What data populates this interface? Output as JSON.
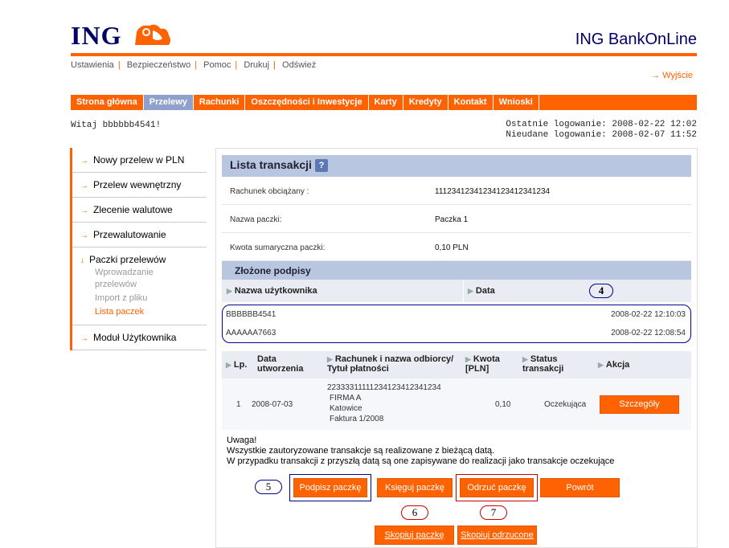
{
  "header": {
    "logo": "ING",
    "brand": "ING BankOnLine"
  },
  "util": [
    "Ustawienia",
    "Bezpieczeństwo",
    "Pomoc",
    "Drukuj",
    "Odśwież"
  ],
  "exit": "→ Wyjście",
  "nav": [
    "Strona główna",
    "Przelewy",
    "Rachunki",
    "Oszczędności i Inwestycje",
    "Karty",
    "Kredyty",
    "Kontakt",
    "Wnioski"
  ],
  "welcome": "Witaj bbbbbb4541!",
  "login": {
    "last": "Ostatnie logowanie: 2008-02-22 12:02",
    "failed": "Nieudane logowanie: 2008-02-07 11:52"
  },
  "sidebar": {
    "items": [
      "Nowy przelew w PLN",
      "Przelew wewnętrzny",
      "Zlecenie walutowe",
      "Przewalutowanie",
      "Paczki przelewów",
      "Moduł Użytkownika"
    ],
    "sub": [
      "Wprowadzanie przelewów",
      "Import z pliku",
      "Lista paczek"
    ]
  },
  "main": {
    "title": "Lista transakcji",
    "help": "?",
    "fields": [
      {
        "label": "Rachunek obciążany :",
        "value": "11123412341234123412341234"
      },
      {
        "label": "Nazwa paczki:",
        "value": "Paczka 1"
      },
      {
        "label": "Kwota sumaryczna paczki:",
        "value": "0,10 PLN"
      }
    ],
    "sign_title": "Złożone podpisy",
    "sign_cols": [
      "Nazwa użytkownika",
      "Data"
    ],
    "signatures": [
      [
        "BBBBBB4541",
        "2008-02-22 12:10:03"
      ],
      [
        "AAAAAA7663",
        "2008-02-22 12:08:54"
      ]
    ],
    "tx_cols": [
      "Lp.",
      "Data utworzenia",
      "Rachunek i nazwa odbiorcy/ Tytuł płatności",
      "Kwota [PLN]",
      "Status transakcji",
      "Akcja"
    ],
    "tx": {
      "lp": "1",
      "date": "2008-07-03",
      "account": "22333311111234123412341234",
      "name": "FIRMA A",
      "city": "Katowice",
      "title": "Faktura 1/2008",
      "amount": "0,10",
      "status": "Oczekująca",
      "action": "Szczegóły"
    },
    "note": [
      "Uwaga!",
      "Wszystkie zautoryzowane transakcje są realizowane z bieżącą datą.",
      "W przypadku transakcji z przyszłą datą są one zapisywane do realizacji jako transakcje oczekujące"
    ],
    "buttons": [
      "Podpisz paczkę",
      "Księguj paczkę",
      "Odrzuć paczkę",
      "Powrót",
      "Skopiuj paczkę",
      "Skopiuj odrzucone"
    ],
    "callouts": [
      "4",
      "5",
      "6",
      "7"
    ]
  }
}
